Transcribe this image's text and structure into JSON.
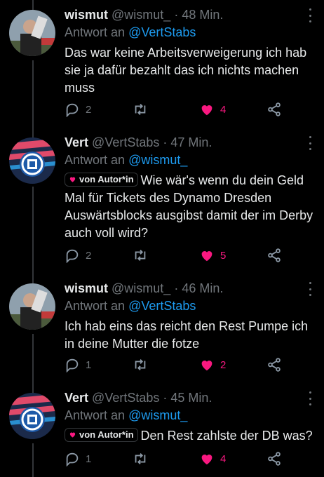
{
  "colors": {
    "background": "#000000",
    "text": "#e7e9ea",
    "muted": "#71767b",
    "link": "#1d9bf0",
    "like": "#f91880",
    "thread_line": "#333639"
  },
  "tweets": [
    {
      "name": "wismut",
      "handle": "@wismut_",
      "separator": "·",
      "time": "48 Min.",
      "reply_prefix": "Antwort an",
      "reply_mention": "@VertStabs",
      "author_badge": "",
      "text": "Das war keine Arbeitsverweigerung ich hab sie ja dafür bezahlt das ich nichts machen muss",
      "replies": "2",
      "retweets": "",
      "likes": "4",
      "avatar": "wismut-avatar"
    },
    {
      "name": "Vert",
      "handle": "@VertStabs",
      "separator": "·",
      "time": "47 Min.",
      "reply_prefix": "Antwort an",
      "reply_mention": "@wismut_",
      "author_badge": "von Autor*in",
      "text": "Wie wär's wenn du dein Geld Mal für Tickets des Dynamo Dresden Auswärtsblocks ausgibst damit der im Derby auch voll wird?",
      "replies": "2",
      "retweets": "",
      "likes": "5",
      "avatar": "schalke-avatar"
    },
    {
      "name": "wismut",
      "handle": "@wismut_",
      "separator": "·",
      "time": "46 Min.",
      "reply_prefix": "Antwort an",
      "reply_mention": "@VertStabs",
      "author_badge": "",
      "text": "Ich hab eins das reicht den Rest Pumpe ich in deine Mutter die fotze",
      "replies": "1",
      "retweets": "",
      "likes": "2",
      "avatar": "wismut-avatar"
    },
    {
      "name": "Vert",
      "handle": "@VertStabs",
      "separator": "·",
      "time": "45 Min.",
      "reply_prefix": "Antwort an",
      "reply_mention": "@wismut_",
      "author_badge": "von Autor*in",
      "text": "Den Rest zahlste der DB was?",
      "replies": "1",
      "retweets": "",
      "likes": "4",
      "avatar": "schalke-avatar"
    }
  ]
}
